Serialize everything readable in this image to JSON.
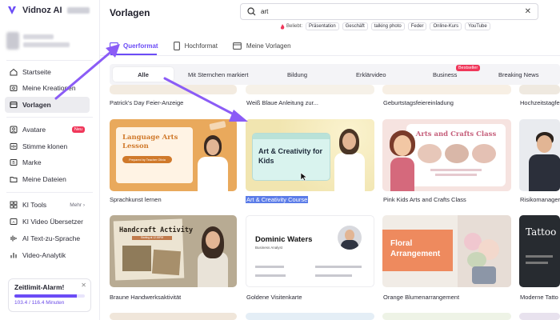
{
  "app": {
    "logo_text": "Vidnoz AI"
  },
  "sidebar": {
    "items": [
      {
        "label": "Startseite",
        "icon": "home-icon"
      },
      {
        "label": "Meine Kreationen",
        "icon": "folder-icon"
      },
      {
        "label": "Vorlagen",
        "icon": "template-icon",
        "active": true
      },
      {
        "label": "Avatare",
        "icon": "avatar-icon",
        "badge": "Neu"
      },
      {
        "label": "Stimme klonen",
        "icon": "voice-icon"
      },
      {
        "label": "Marke",
        "icon": "brand-icon"
      },
      {
        "label": "Meine Dateien",
        "icon": "files-icon"
      },
      {
        "label": "KI Tools",
        "icon": "tools-icon",
        "more": "Mehr"
      },
      {
        "label": "KI Video Übersetzer",
        "icon": "translate-icon"
      },
      {
        "label": "AI Text-zu-Sprache",
        "icon": "tts-icon"
      },
      {
        "label": "Video-Analytik",
        "icon": "analytics-icon"
      }
    ]
  },
  "alarm": {
    "title": "Zeitlimit-Alarm!",
    "usage_text": "103.4 / 116.4 Minuten",
    "progress": 0.888
  },
  "header": {
    "title": "Vorlagen"
  },
  "search": {
    "value": "art",
    "popular_label": "Beliebt:",
    "chips": [
      "Präsentation",
      "Geschäft",
      "talking photo",
      "Feder",
      "Online-Kurs",
      "YouTube"
    ]
  },
  "format_tabs": [
    {
      "label": "Querformat",
      "active": true
    },
    {
      "label": "Hochformat"
    },
    {
      "label": "Meine Vorlagen"
    }
  ],
  "categories": {
    "items": [
      "Alle",
      "Mit Sternchen markiert",
      "Bildung",
      "Erklärvideo",
      "Business",
      "Breaking News"
    ],
    "active": "Alle",
    "business_badge": "Bestseller"
  },
  "templates": {
    "row0": [
      "Patrick's Day Feier-Anzeige",
      "Weiß Blaue Anleitung zur...",
      "Geburtstagsfeiereinladung",
      "Hochzeitstagfeier"
    ],
    "row1": [
      {
        "title": "Sprachkunst lernen",
        "thumb_title": "Language Arts Lesson",
        "thumb_sub": "Prepared by Teacher Olivia"
      },
      {
        "title": "Art & Creativity Course",
        "thumb_title": "Art & Creativity for Kids",
        "selected": true
      },
      {
        "title": "Pink Kids Arts and Crafts Class",
        "thumb_title": "Arts and Crafts Class"
      },
      {
        "title": "Risikomanager"
      }
    ],
    "row2": [
      {
        "title": "Braune Handwerksaktivität",
        "thumb_title": "Handcraft Activity",
        "thumb_sub": "Starting at 12.00PM"
      },
      {
        "title": "Goldene Visitenkarte",
        "thumb_title": "Dominic Waters",
        "thumb_sub": "Business Analyst"
      },
      {
        "title": "Orange Blumenarrangement",
        "thumb_title": "Floral Arrangement"
      },
      {
        "title": "Moderne Tatto",
        "thumb_title": "Tattoo"
      }
    ]
  },
  "colors": {
    "accent": "#6b4cf6",
    "badge": "#f0375a"
  }
}
